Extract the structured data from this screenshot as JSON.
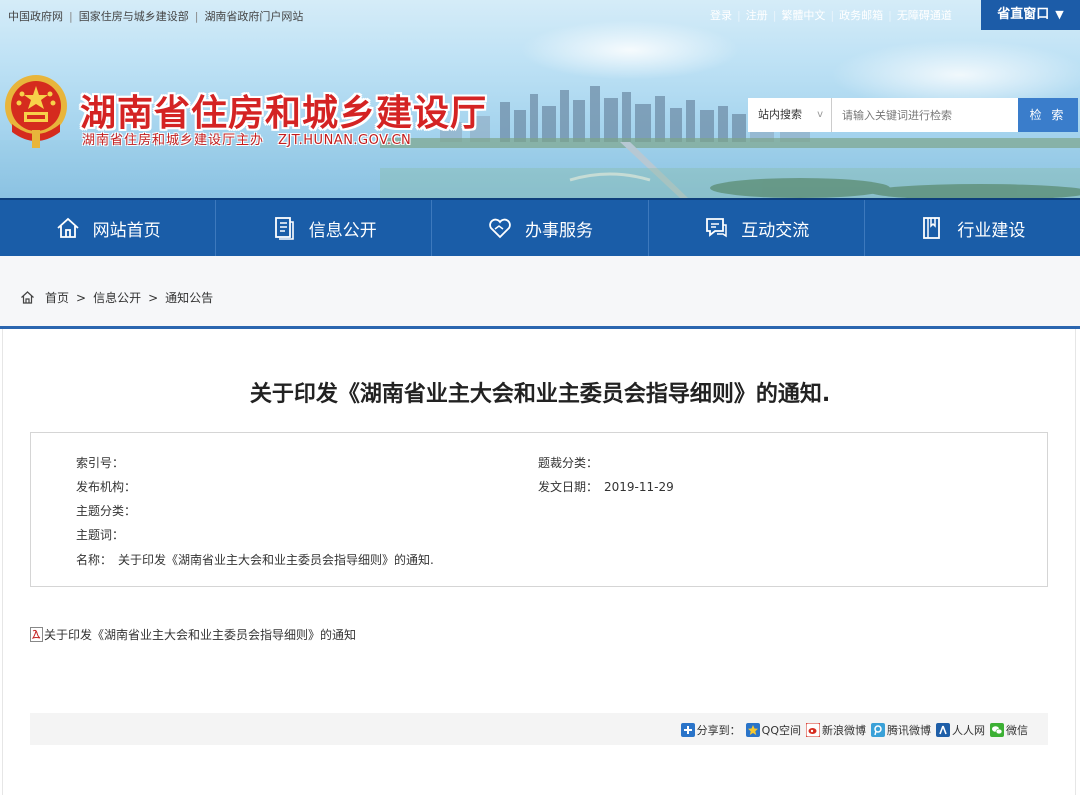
{
  "top_links": [
    "中国政府网",
    "国家住房与城乡建设部",
    "湖南省政府门户网站"
  ],
  "user_links": [
    "登录",
    "注册",
    "繁體中文",
    "政务邮箱",
    "无障碍通道"
  ],
  "province_window": "省直窗口",
  "site": {
    "title": "湖南省住房和城乡建设厅",
    "subtitle": "湖南省住房和城乡建设厅主办",
    "domain": "ZJT.HUNAN.GOV.CN"
  },
  "search": {
    "scope": "站内搜索",
    "placeholder": "请输入关键词进行检索",
    "button": "检 索"
  },
  "nav": [
    "网站首页",
    "信息公开",
    "办事服务",
    "互动交流",
    "行业建设"
  ],
  "breadcrumb": [
    "首页",
    "信息公开",
    "通知公告"
  ],
  "breadcrumb_sep": ">",
  "document": {
    "title": "关于印发《湖南省业主大会和业主委员会指导细则》的通知.",
    "info": {
      "index_label": "索引号：",
      "index_value": "",
      "topic_cat_label": "题裁分类：",
      "topic_cat_value": "",
      "publisher_label": "发布机构：",
      "publisher_value": "",
      "date_label": "发文日期：",
      "date_value": "2019-11-29",
      "subject_label": "主题分类：",
      "subject_value": "",
      "keywords_label": "主题词：",
      "keywords_value": "",
      "name_label": "名称：",
      "name_value": "关于印发《湖南省业主大会和业主委员会指导细则》的通知."
    },
    "attachment": "关于印发《湖南省业主大会和业主委员会指导细则》的通知"
  },
  "share": {
    "label": "分享到：",
    "targets": [
      "QQ空间",
      "新浪微博",
      "腾讯微博",
      "人人网",
      "微信"
    ]
  },
  "colors": {
    "nav_blue": "#1a5da8",
    "title_red": "#d42323",
    "search_button": "#3a7dcb"
  }
}
